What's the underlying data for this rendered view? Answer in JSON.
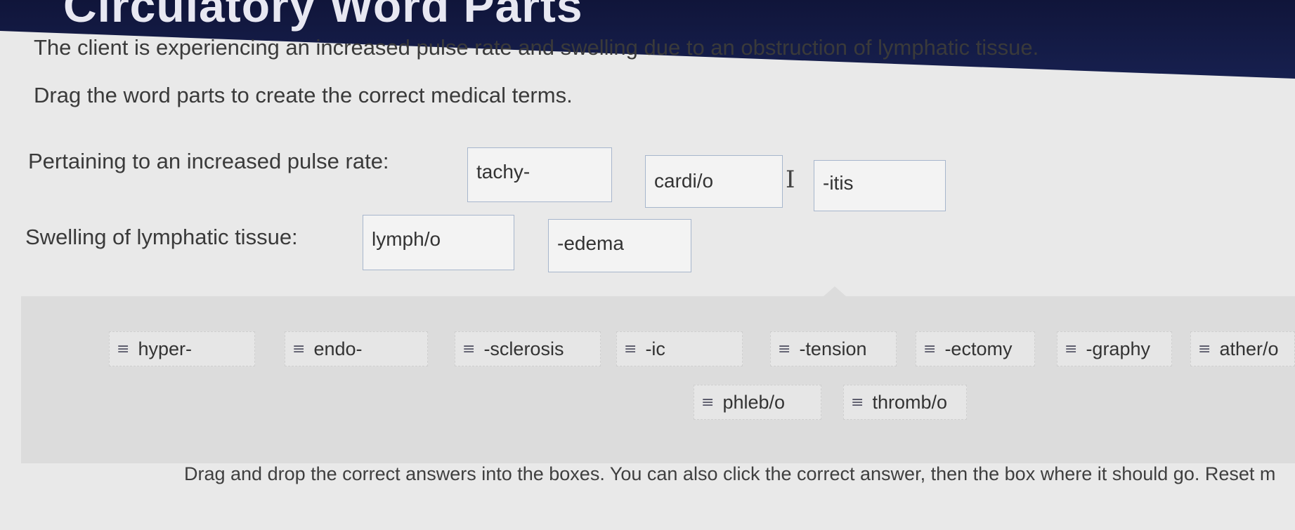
{
  "header": {
    "title": "Circulatory Word Parts"
  },
  "question": {
    "intro": "The client is experiencing an increased pulse rate and swelling due to an obstruction of lymphatic tissue.",
    "instruction": "Drag the word parts to create the correct medical terms."
  },
  "rows": [
    {
      "label": "Pertaining to an increased pulse rate:",
      "boxes": [
        "tachy-",
        "cardi/o",
        "-itis"
      ]
    },
    {
      "label": "Swelling of lymphatic tissue:",
      "boxes": [
        "lymph/o",
        "-edema"
      ]
    }
  ],
  "bank": {
    "grip_icon": "≡",
    "chips": [
      "hyper-",
      "endo-",
      "-sclerosis",
      "-ic",
      "-tension",
      "-ectomy",
      "-graphy",
      "ather/o",
      "phleb/o",
      "thromb/o"
    ]
  },
  "footer": {
    "text": "Drag and drop the correct answers into the boxes. You can also click the correct answer, then the box where it should go. Reset m"
  }
}
